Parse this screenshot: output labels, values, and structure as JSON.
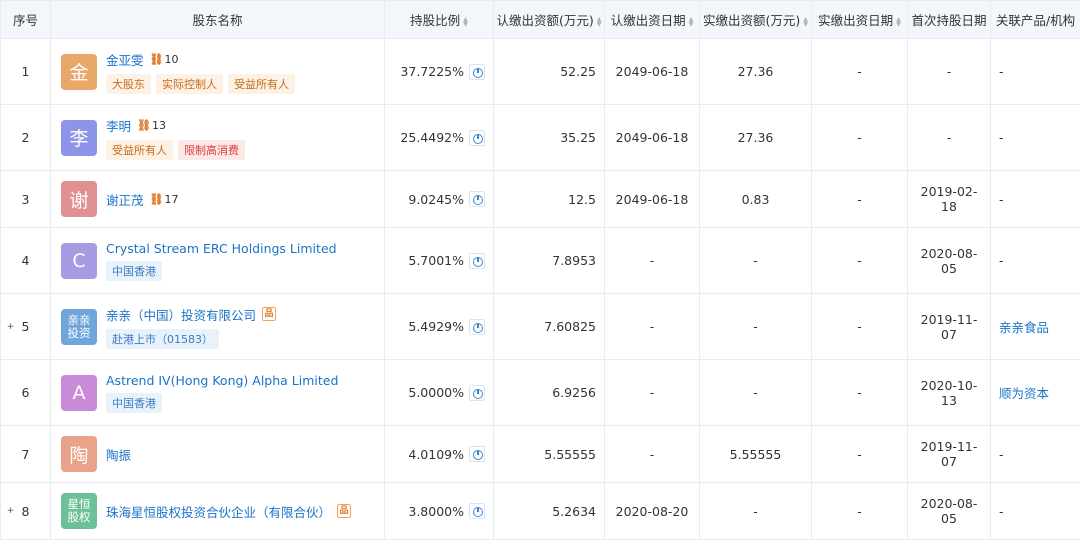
{
  "header": {
    "idx": "序号",
    "holder": "股东名称",
    "ratio": "持股比例",
    "subscribed_amount": "认缴出资额(万元)",
    "subscribed_date": "认缴出资日期",
    "paid_amount": "实缴出资额(万元)",
    "paid_date": "实缴出资日期",
    "first_date": "首次持股日期",
    "related": "关联产品/机构"
  },
  "rows": [
    {
      "idx": "1",
      "avatar": "金",
      "avatar_color": "#e8a869",
      "name": "金亚雯",
      "chain": "10",
      "tags": [
        "大股东",
        "实际控制人",
        "受益所有人"
      ],
      "ratio": "37.7225%",
      "sub_amount": "52.25",
      "sub_date": "2049-06-18",
      "paid_amount": "27.36",
      "paid_date": "-",
      "first_date": "-",
      "related": "-"
    },
    {
      "idx": "2",
      "avatar": "李",
      "avatar_color": "#8e95e8",
      "name": "李明",
      "chain": "13",
      "tags": [
        "受益所有人",
        "限制高消费"
      ],
      "ratio": "25.4492%",
      "sub_amount": "35.25",
      "sub_date": "2049-06-18",
      "paid_amount": "27.36",
      "paid_date": "-",
      "first_date": "-",
      "related": "-"
    },
    {
      "idx": "3",
      "avatar": "谢",
      "avatar_color": "#e09090",
      "name": "谢正茂",
      "chain": "17",
      "tags": [],
      "ratio": "9.0245%",
      "sub_amount": "12.5",
      "sub_date": "2049-06-18",
      "paid_amount": "0.83",
      "paid_date": "-",
      "first_date": "2019-02-18",
      "related": "-"
    },
    {
      "idx": "4",
      "avatar": "C",
      "avatar_color": "#a99be3",
      "name": "Crystal Stream ERC Holdings Limited",
      "tags": [
        "中国香港"
      ],
      "ratio": "5.7001%",
      "sub_amount": "7.8953",
      "sub_date": "-",
      "paid_amount": "-",
      "paid_date": "-",
      "first_date": "2020-08-05",
      "related": "-"
    },
    {
      "idx": "5",
      "expand": "+",
      "avatar": "亲亲\n投资",
      "avatar_color": "#6fa5db",
      "name": "亲亲（中国）投资有限公司",
      "tags": [
        "赴港上市（01583）"
      ],
      "ratio": "5.4929%",
      "sub_amount": "7.60825",
      "sub_date": "-",
      "paid_amount": "-",
      "paid_date": "-",
      "first_date": "2019-11-07",
      "related": "亲亲食品"
    },
    {
      "idx": "6",
      "avatar": "A",
      "avatar_color": "#c98ad8",
      "name": "Astrend IV(Hong Kong) Alpha Limited",
      "tags": [
        "中国香港"
      ],
      "ratio": "5.0000%",
      "sub_amount": "6.9256",
      "sub_date": "-",
      "paid_amount": "-",
      "paid_date": "-",
      "first_date": "2020-10-13",
      "related": "顺为资本"
    },
    {
      "idx": "7",
      "avatar": "陶",
      "avatar_color": "#e9a38a",
      "name": "陶振",
      "tags": [],
      "ratio": "4.0109%",
      "sub_amount": "5.55555",
      "sub_date": "-",
      "paid_amount": "5.55555",
      "paid_date": "-",
      "first_date": "2019-11-07",
      "related": "-"
    },
    {
      "idx": "8",
      "expand": "+",
      "avatar": "星恒\n股权",
      "avatar_color": "#6cc197",
      "name": "珠海星恒股权投资合伙企业（有限合伙）",
      "tags": [],
      "ratio": "3.8000%",
      "sub_amount": "5.2634",
      "sub_date": "2020-08-20",
      "paid_amount": "-",
      "paid_date": "-",
      "first_date": "2020-08-05",
      "related": "-"
    }
  ],
  "tag_colors": {
    "大股东": "orange",
    "实际控制人": "orange",
    "受益所有人": "orange",
    "限制高消费": "red",
    "中国香港": "blue",
    "赴港上市（01583）": "blue"
  },
  "org_rows": [
    "5",
    "8"
  ]
}
